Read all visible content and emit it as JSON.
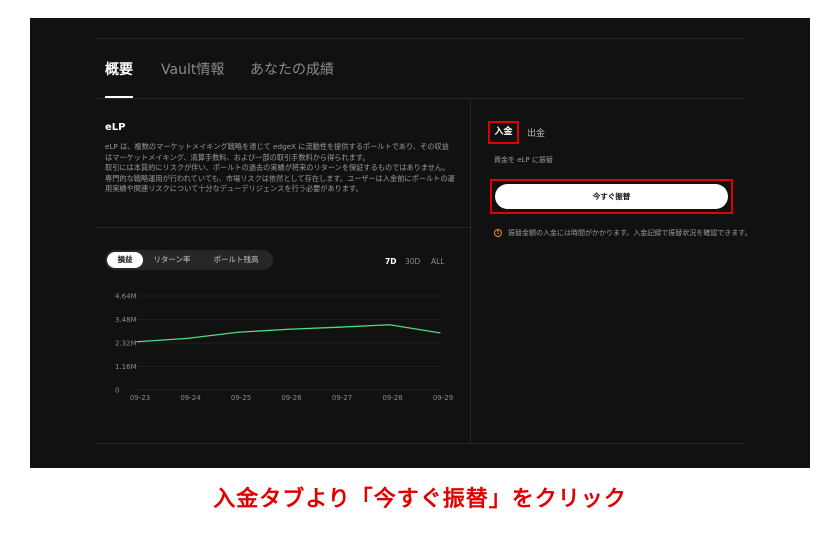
{
  "tabs": [
    {
      "label": "概要",
      "active": true
    },
    {
      "label": "Vault情報",
      "active": false
    },
    {
      "label": "あなたの成績",
      "active": false
    }
  ],
  "vault": {
    "title": "eLP",
    "paragraphs": [
      "eLP は、複数のマーケットメイキング戦略を通じて edgeX に流動性を提供するポールトであり、その収益はマーケットメイキング、清算手数料、および一部の取引手数料から得られます。",
      "取引には本質的にリスクが伴い、ポールトの過去の実績が将来のリターンを保証するものではありません。専門的な戦略運用が行われていても、市場リスクは依然として存在します。ユーザーは入金前にポールトの運用実績や関連リスクについて十分なデューデリジェンスを行う必要があります。"
    ]
  },
  "metric_tabs": [
    {
      "label": "損益",
      "active": true
    },
    {
      "label": "リターン率",
      "active": false
    },
    {
      "label": "ポールト残高",
      "active": false
    }
  ],
  "ranges": [
    {
      "label": "7D",
      "active": true
    },
    {
      "label": "30D",
      "active": false
    },
    {
      "label": "ALL",
      "active": false
    }
  ],
  "chart_data": {
    "type": "line",
    "x": [
      "09-23",
      "09-24",
      "09-25",
      "09-26",
      "09-27",
      "09-28",
      "09-29"
    ],
    "series": [
      {
        "values": [
          2.38,
          2.55,
          2.85,
          3.0,
          3.1,
          3.22,
          2.82
        ],
        "color": "#4ade80"
      }
    ],
    "y_ticks": [
      "0",
      "1.16M",
      "2.32M",
      "3.48M",
      "4.64M"
    ],
    "ylim": [
      0,
      4.64
    ],
    "grid": true
  },
  "deposit": {
    "tabs": [
      {
        "label": "入金",
        "active": true
      },
      {
        "label": "出金",
        "active": false
      }
    ],
    "note": "資金を eLP に振替",
    "button_label": "今すぐ振替",
    "notice": "振替金額の入金には時間がかかります。入金記録で振替状況を確認できます。",
    "notice_icon": "warning-circle-icon"
  },
  "caption": "入金タブより「今すぐ振替」をクリック",
  "colors": {
    "highlight": "#e00000",
    "line": "#4ade80",
    "background": "#111111"
  }
}
